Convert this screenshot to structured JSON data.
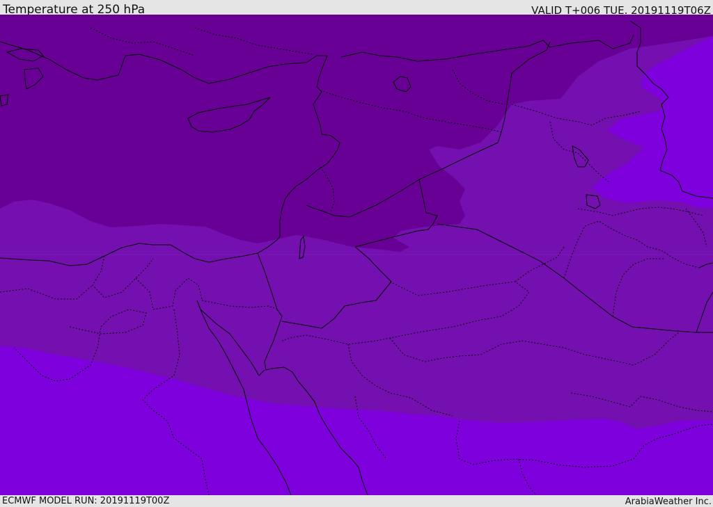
{
  "header": {
    "title": "Temperature at 250 hPa",
    "valid": "VALID T+006 TUE. 20191119T06Z"
  },
  "footer": {
    "model_run": "ECMWF MODEL RUN: 20191119T00Z",
    "credit": "ArabiaWeather Inc."
  },
  "map": {
    "colors": {
      "coldest_band": "#680096",
      "middle_band": "#7410b0",
      "warmest_band": "#7e00dc",
      "coastline": "#000000",
      "border": "#000000"
    }
  }
}
